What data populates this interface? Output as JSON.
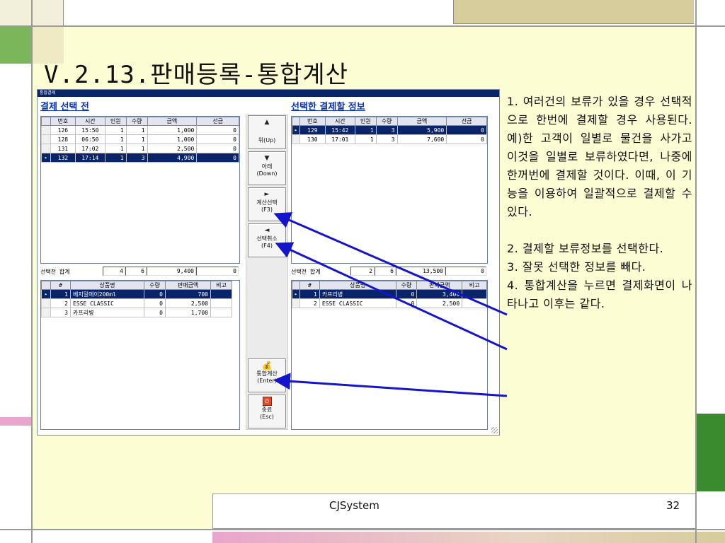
{
  "slide": {
    "title": "V.2.13.판매등록-통합계산",
    "footer_company": "CJSystem",
    "page_number": "32"
  },
  "app": {
    "window_title": "통합결제",
    "left_title": "결제 선택 전",
    "right_title": "선택한 결제할 정보",
    "orders_headers": [
      "번호",
      "시간",
      "인원",
      "수량",
      "금액",
      "선금"
    ],
    "left_orders": [
      {
        "no": "126",
        "time": "15:50",
        "people": "1",
        "qty": "1",
        "amount": "1,000",
        "prepaid": "0",
        "selected": false
      },
      {
        "no": "128",
        "time": "06:50",
        "people": "1",
        "qty": "1",
        "amount": "1,000",
        "prepaid": "0",
        "selected": false
      },
      {
        "no": "131",
        "time": "17:02",
        "people": "1",
        "qty": "1",
        "amount": "2,500",
        "prepaid": "0",
        "selected": false
      },
      {
        "no": "132",
        "time": "17:14",
        "people": "1",
        "qty": "3",
        "amount": "4,900",
        "prepaid": "0",
        "selected": true
      }
    ],
    "right_orders": [
      {
        "no": "129",
        "time": "15:42",
        "people": "1",
        "qty": "3",
        "amount": "5,900",
        "prepaid": "0",
        "selected": true
      },
      {
        "no": "130",
        "time": "17:01",
        "people": "1",
        "qty": "3",
        "amount": "7,600",
        "prepaid": "0",
        "selected": false
      }
    ],
    "left_summary": {
      "label": "선택전 합계",
      "count": "4",
      "qty": "6",
      "amount": "9,400",
      "prepaid": "0"
    },
    "right_summary": {
      "label": "선택전 합계",
      "count": "2",
      "qty": "6",
      "amount": "13,500",
      "prepaid": "0"
    },
    "items_headers": [
      "#",
      "상품명",
      "수량",
      "판매금액",
      "비고"
    ],
    "left_items": [
      {
        "idx": "1",
        "name": "베지밀에이200ml",
        "qty": "0",
        "amount": "700",
        "note": "",
        "selected": true
      },
      {
        "idx": "2",
        "name": "ESSE CLASSIC",
        "qty": "0",
        "amount": "2,500",
        "note": "",
        "selected": false
      },
      {
        "idx": "3",
        "name": "카프리병",
        "qty": "0",
        "amount": "1,700",
        "note": "",
        "selected": false
      }
    ],
    "right_items": [
      {
        "idx": "1",
        "name": "카프리병",
        "qty": "0",
        "amount": "3,400",
        "note": "",
        "selected": true
      },
      {
        "idx": "2",
        "name": "ESSE CLASSIC",
        "qty": "0",
        "amount": "2,500",
        "note": "",
        "selected": false
      }
    ],
    "buttons": {
      "up": {
        "line1": "위(Up)"
      },
      "down": {
        "line1": "아래",
        "line2": "(Down)"
      },
      "select": {
        "line1": "계산선택",
        "line2": "(F3)"
      },
      "cancel": {
        "line1": "선택취소",
        "line2": "(F4)"
      },
      "merge": {
        "line1": "통합계산",
        "line2": "(Enter)"
      },
      "exit": {
        "line1": "종료",
        "line2": "(Esc)"
      }
    }
  },
  "notes": [
    "1. 여러건의 보류가 있을 경우 선택적으로 한번에 결제할 경우 사용된다. 예)한 고객이 일별로 물건을 사가고 이것을 일별로 보류하였다면, 나중에 한꺼번에 결제할 것이다. 이때, 이 기능을 이용하여 일괄적으로 결제할 수 있다.",
    "2. 결제할 보류정보를 선택한다.",
    "3. 잘못 선택한 정보를 빼다.",
    "4. 통합계산을 누르면 결제화면이 나타나고 이후는 같다."
  ],
  "colors": {
    "slide_bg": "#fdfdd4",
    "accent_green": "#3a8b2e",
    "accent_tan": "#d6cc9c",
    "accent_pink": "#e9a5cc",
    "selected_row": "#0a246a",
    "arrow": "#1414cc"
  }
}
